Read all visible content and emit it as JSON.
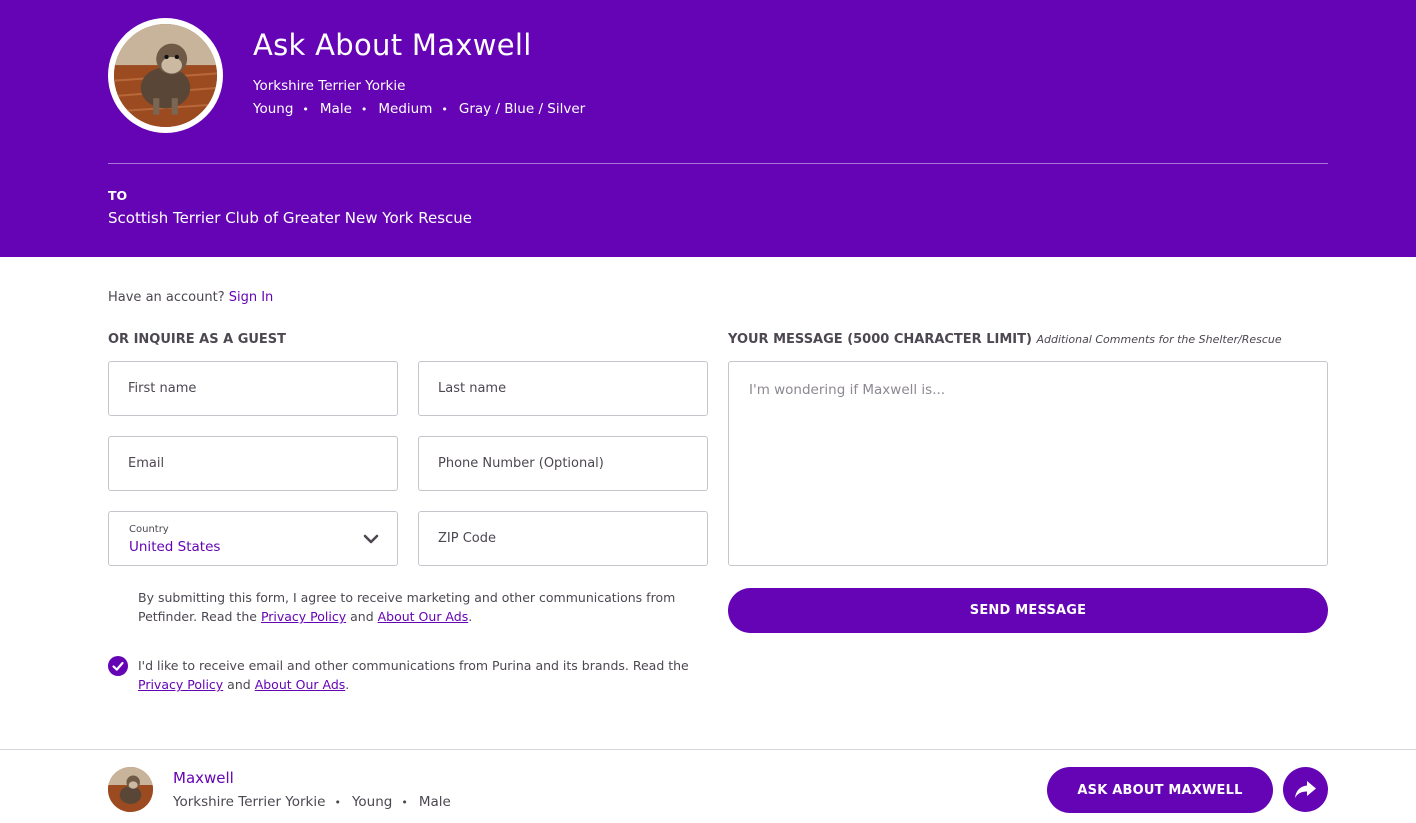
{
  "header": {
    "title": "Ask About Maxwell",
    "breed": "Yorkshire Terrier Yorkie",
    "attributes": [
      "Young",
      "Male",
      "Medium",
      "Gray / Blue / Silver"
    ],
    "to_label": "TO",
    "to_value": "Scottish Terrier Club of Greater New York Rescue"
  },
  "account": {
    "prompt": "Have an account?",
    "sign_in": "Sign In"
  },
  "guest_form": {
    "title": "OR INQUIRE AS A GUEST",
    "first_name_placeholder": "First name",
    "last_name_placeholder": "Last name",
    "email_placeholder": "Email",
    "phone_placeholder": "Phone Number (Optional)",
    "country_label": "Country",
    "country_value": "United States",
    "zip_placeholder": "ZIP Code"
  },
  "message": {
    "title": "YOUR MESSAGE (5000 CHARACTER LIMIT)",
    "subtitle": "Additional Comments for the Shelter/Rescue",
    "placeholder": "I'm wondering if Maxwell is..."
  },
  "send_button": "SEND MESSAGE",
  "consent_petfinder": {
    "text": "By submitting this form, I agree to receive marketing and other communications from Petfinder. Read the",
    "privacy": "Privacy Policy",
    "and": "and",
    "ads": "About Our Ads",
    "end": "."
  },
  "consent_purina": {
    "checked": true,
    "text": "I'd like to receive email and other communications from Purina and its brands. Read the",
    "privacy": "Privacy Policy",
    "and": "and",
    "ads": "About Our Ads",
    "end": "."
  },
  "bottom_bar": {
    "name": "Maxwell",
    "attributes": [
      "Yorkshire Terrier Yorkie",
      "Young",
      "Male"
    ],
    "ask_button": "ASK ABOUT MAXWELL"
  },
  "icons": {
    "chevron": "chevron-down-icon",
    "check": "check-icon",
    "share": "share-icon"
  },
  "colors": {
    "brand": "#6504b5",
    "text": "#4d4751",
    "border": "#c9c4cc"
  }
}
